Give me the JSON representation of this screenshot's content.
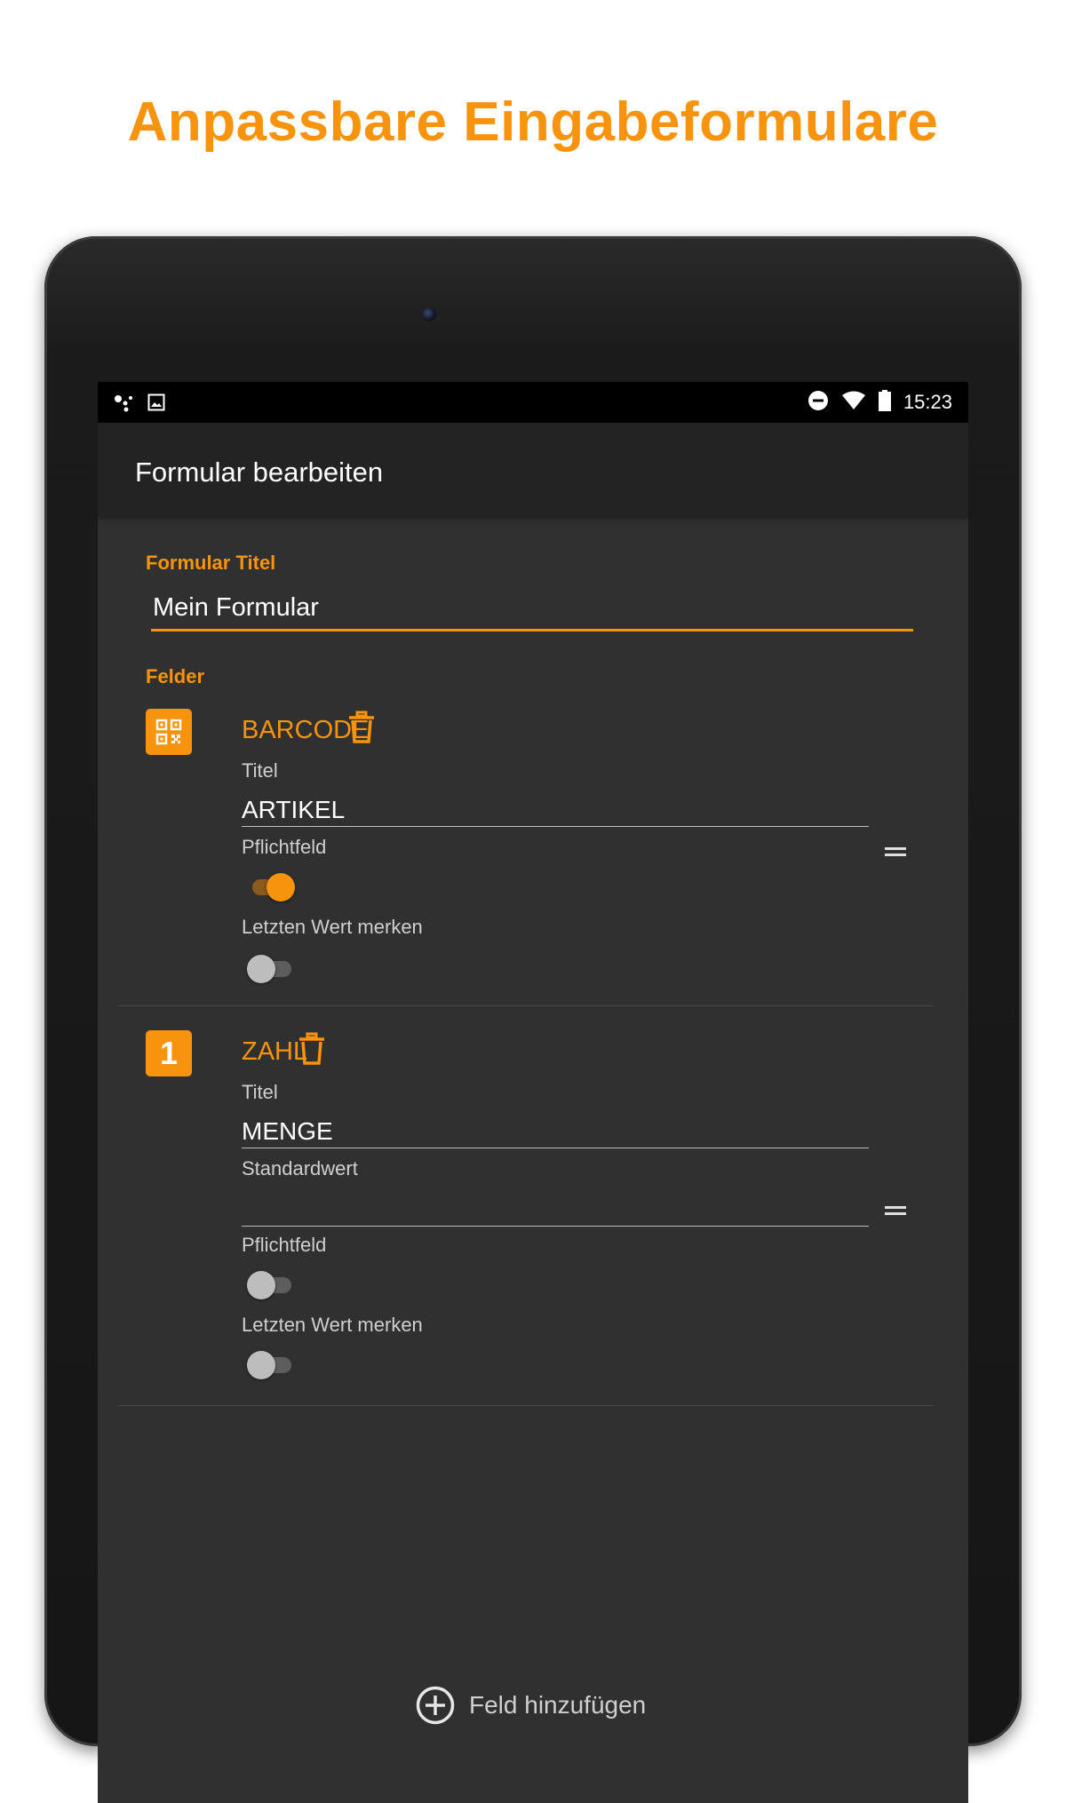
{
  "headline": "Anpassbare Eingabeformulare",
  "colors": {
    "accent": "#f7930c",
    "screen_bg": "#303030",
    "appbar_bg": "#232323"
  },
  "status_bar": {
    "left_icons": [
      "assistant-dots-icon",
      "image-icon"
    ],
    "right_icons": [
      "do-not-disturb-icon",
      "wifi-icon",
      "battery-icon"
    ],
    "time": "15:23"
  },
  "appbar": {
    "title": "Formular bearbeiten"
  },
  "form": {
    "title_label": "Formular Titel",
    "title_value": "Mein Formular",
    "fields_label": "Felder",
    "fields": [
      {
        "type": "BARCODE",
        "type_icon": "qr-code-icon",
        "title_label": "Titel",
        "title_value": "ARTIKEL",
        "required_label": "Pflichtfeld",
        "required": true,
        "remember_label": "Letzten Wert merken",
        "remember": false
      },
      {
        "type": "ZAHL",
        "type_badge": "1",
        "title_label": "Titel",
        "title_value": "MENGE",
        "default_label": "Standardwert",
        "default_value": "",
        "required_label": "Pflichtfeld",
        "required": false,
        "remember_label": "Letzten Wert merken",
        "remember": false
      }
    ],
    "add_field_label": "Feld hinzufügen"
  }
}
